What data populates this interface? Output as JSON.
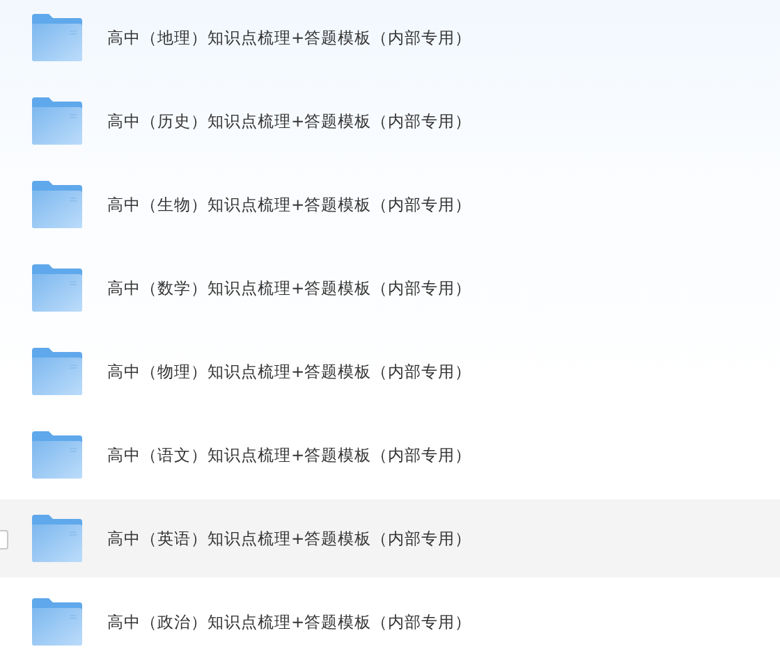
{
  "files": [
    {
      "name": "高中（地理）知识点梳理+答题模板（内部专用）",
      "highlighted": false
    },
    {
      "name": "高中（历史）知识点梳理+答题模板（内部专用）",
      "highlighted": false
    },
    {
      "name": "高中（生物）知识点梳理+答题模板（内部专用）",
      "highlighted": false
    },
    {
      "name": "高中（数学）知识点梳理+答题模板（内部专用）",
      "highlighted": false
    },
    {
      "name": "高中（物理）知识点梳理+答题模板（内部专用）",
      "highlighted": false
    },
    {
      "name": "高中（语文）知识点梳理+答题模板（内部专用）",
      "highlighted": false
    },
    {
      "name": "高中（英语）知识点梳理+答题模板（内部专用）",
      "highlighted": true
    },
    {
      "name": "高中（政治）知识点梳理+答题模板（内部专用）",
      "highlighted": false
    }
  ]
}
